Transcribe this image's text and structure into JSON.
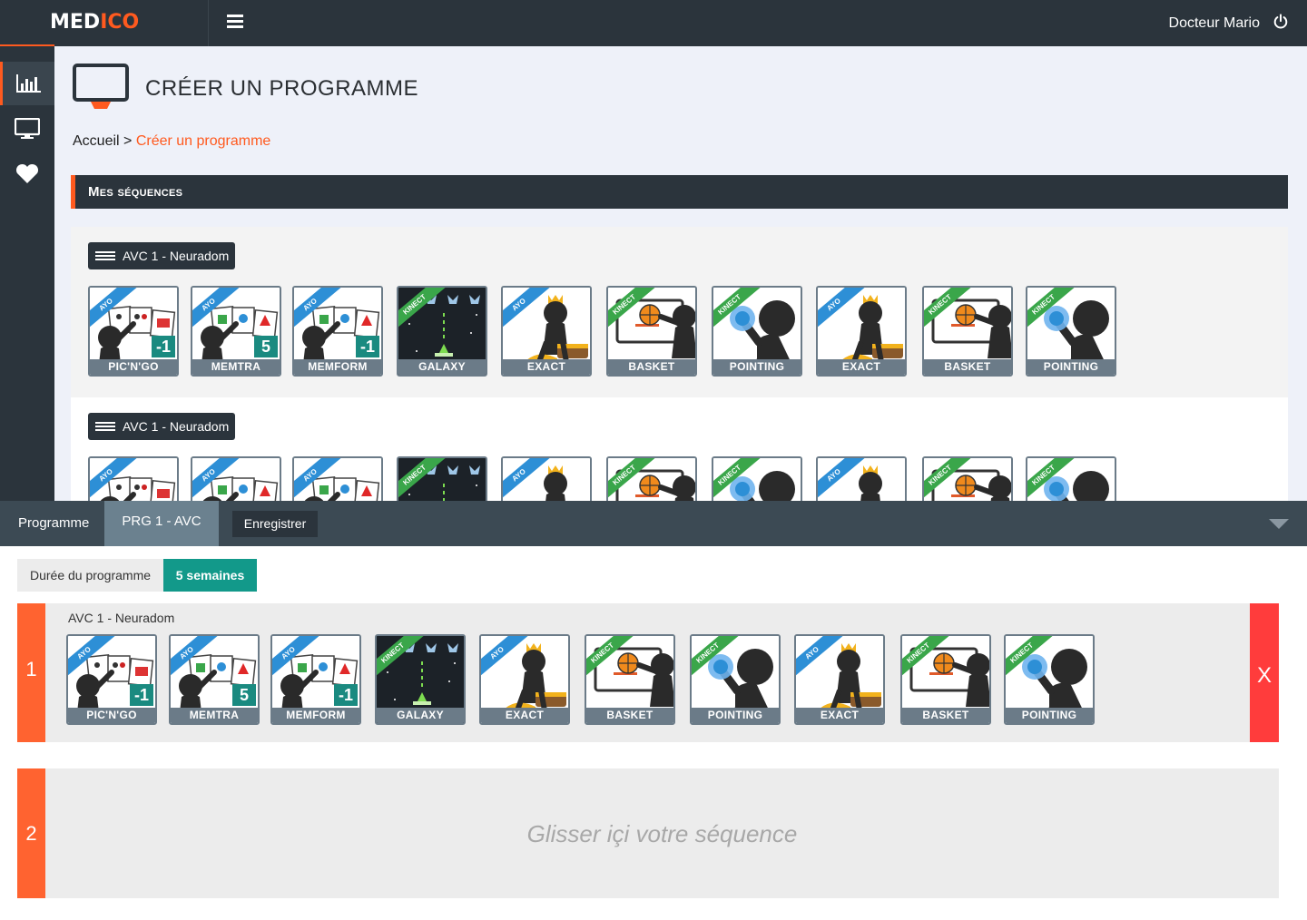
{
  "header": {
    "logo_part1": "MED",
    "logo_part2": "ICO",
    "user_name": "Docteur Mario",
    "icons": [
      "menu-icon",
      "power-icon"
    ]
  },
  "sidebar": {
    "items": [
      {
        "name": "stats",
        "icon": "bar-chart-icon",
        "active": true
      },
      {
        "name": "programs",
        "icon": "monitor-icon",
        "active": false
      },
      {
        "name": "favorites",
        "icon": "heart-icon",
        "active": false
      }
    ]
  },
  "page": {
    "title": "CRÉER UN PROGRAMME",
    "icon": "monitor-icon"
  },
  "breadcrumb": {
    "home": "Accueil",
    "separator": ">",
    "current": "Créer un programme"
  },
  "sequences_panel": {
    "title": "Mes séquences",
    "sequences": [
      {
        "name": "AVC 1 - Neuradom"
      },
      {
        "name": "AVC 1 - Neuradom"
      }
    ]
  },
  "games": [
    {
      "label": "PIC'N'GO",
      "brand": "AYO",
      "art": "picngo",
      "badge": "-1"
    },
    {
      "label": "MEMTRA",
      "brand": "AYO",
      "art": "mem",
      "badge": "5"
    },
    {
      "label": "MEMFORM",
      "brand": "AYO",
      "art": "mem",
      "badge": "-1"
    },
    {
      "label": "GALAXY",
      "brand": "KINECT",
      "art": "galaxy",
      "badge": ""
    },
    {
      "label": "EXACT",
      "brand": "AYO",
      "art": "exact",
      "badge": ""
    },
    {
      "label": "BASKET",
      "brand": "KINECT",
      "art": "basket",
      "badge": ""
    },
    {
      "label": "POINTING",
      "brand": "KINECT",
      "art": "pointing",
      "badge": ""
    },
    {
      "label": "EXACT",
      "brand": "AYO",
      "art": "exact",
      "badge": ""
    },
    {
      "label": "BASKET",
      "brand": "KINECT",
      "art": "basket",
      "badge": ""
    },
    {
      "label": "POINTING",
      "brand": "KINECT",
      "art": "pointing",
      "badge": ""
    }
  ],
  "program_bar": {
    "label": "Programme",
    "active_tab": "PRG 1 - AVC",
    "save_label": "Enregistrer"
  },
  "duration": {
    "label": "Durée du programme",
    "value": "5 semaines"
  },
  "weeks": [
    {
      "number": "1",
      "sequence_name": "AVC 1 - Neuradom",
      "remove_label": "X"
    },
    {
      "number": "2",
      "drop_hint": "Glisser içi votre séquence"
    }
  ],
  "colors": {
    "accent": "#ff5a1f",
    "dark": "#2b343c",
    "teal": "#12998a",
    "danger": "#ff3c3c",
    "ayo": "#2d8fd6",
    "kinect": "#3aa64a"
  }
}
